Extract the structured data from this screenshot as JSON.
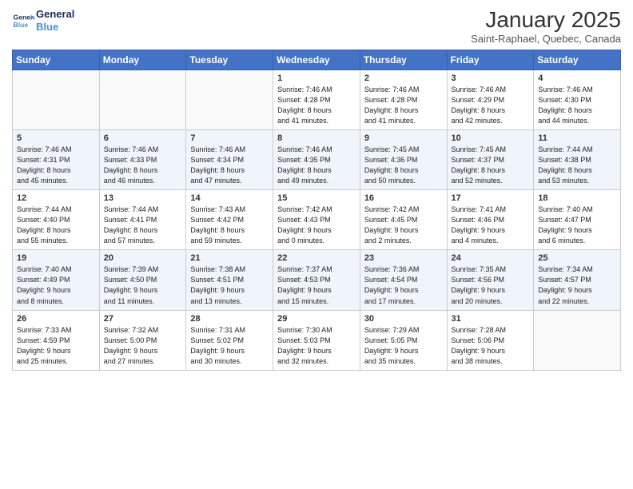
{
  "logo": {
    "line1": "General",
    "line2": "Blue"
  },
  "title": "January 2025",
  "subtitle": "Saint-Raphael, Quebec, Canada",
  "weekdays": [
    "Sunday",
    "Monday",
    "Tuesday",
    "Wednesday",
    "Thursday",
    "Friday",
    "Saturday"
  ],
  "weeks": [
    [
      {
        "day": "",
        "info": ""
      },
      {
        "day": "",
        "info": ""
      },
      {
        "day": "",
        "info": ""
      },
      {
        "day": "1",
        "info": "Sunrise: 7:46 AM\nSunset: 4:28 PM\nDaylight: 8 hours\nand 41 minutes."
      },
      {
        "day": "2",
        "info": "Sunrise: 7:46 AM\nSunset: 4:28 PM\nDaylight: 8 hours\nand 41 minutes."
      },
      {
        "day": "3",
        "info": "Sunrise: 7:46 AM\nSunset: 4:29 PM\nDaylight: 8 hours\nand 42 minutes."
      },
      {
        "day": "4",
        "info": "Sunrise: 7:46 AM\nSunset: 4:30 PM\nDaylight: 8 hours\nand 44 minutes."
      }
    ],
    [
      {
        "day": "5",
        "info": "Sunrise: 7:46 AM\nSunset: 4:31 PM\nDaylight: 8 hours\nand 45 minutes."
      },
      {
        "day": "6",
        "info": "Sunrise: 7:46 AM\nSunset: 4:33 PM\nDaylight: 8 hours\nand 46 minutes."
      },
      {
        "day": "7",
        "info": "Sunrise: 7:46 AM\nSunset: 4:34 PM\nDaylight: 8 hours\nand 47 minutes."
      },
      {
        "day": "8",
        "info": "Sunrise: 7:46 AM\nSunset: 4:35 PM\nDaylight: 8 hours\nand 49 minutes."
      },
      {
        "day": "9",
        "info": "Sunrise: 7:45 AM\nSunset: 4:36 PM\nDaylight: 8 hours\nand 50 minutes."
      },
      {
        "day": "10",
        "info": "Sunrise: 7:45 AM\nSunset: 4:37 PM\nDaylight: 8 hours\nand 52 minutes."
      },
      {
        "day": "11",
        "info": "Sunrise: 7:44 AM\nSunset: 4:38 PM\nDaylight: 8 hours\nand 53 minutes."
      }
    ],
    [
      {
        "day": "12",
        "info": "Sunrise: 7:44 AM\nSunset: 4:40 PM\nDaylight: 8 hours\nand 55 minutes."
      },
      {
        "day": "13",
        "info": "Sunrise: 7:44 AM\nSunset: 4:41 PM\nDaylight: 8 hours\nand 57 minutes."
      },
      {
        "day": "14",
        "info": "Sunrise: 7:43 AM\nSunset: 4:42 PM\nDaylight: 8 hours\nand 59 minutes."
      },
      {
        "day": "15",
        "info": "Sunrise: 7:42 AM\nSunset: 4:43 PM\nDaylight: 9 hours\nand 0 minutes."
      },
      {
        "day": "16",
        "info": "Sunrise: 7:42 AM\nSunset: 4:45 PM\nDaylight: 9 hours\nand 2 minutes."
      },
      {
        "day": "17",
        "info": "Sunrise: 7:41 AM\nSunset: 4:46 PM\nDaylight: 9 hours\nand 4 minutes."
      },
      {
        "day": "18",
        "info": "Sunrise: 7:40 AM\nSunset: 4:47 PM\nDaylight: 9 hours\nand 6 minutes."
      }
    ],
    [
      {
        "day": "19",
        "info": "Sunrise: 7:40 AM\nSunset: 4:49 PM\nDaylight: 9 hours\nand 8 minutes."
      },
      {
        "day": "20",
        "info": "Sunrise: 7:39 AM\nSunset: 4:50 PM\nDaylight: 9 hours\nand 11 minutes."
      },
      {
        "day": "21",
        "info": "Sunrise: 7:38 AM\nSunset: 4:51 PM\nDaylight: 9 hours\nand 13 minutes."
      },
      {
        "day": "22",
        "info": "Sunrise: 7:37 AM\nSunset: 4:53 PM\nDaylight: 9 hours\nand 15 minutes."
      },
      {
        "day": "23",
        "info": "Sunrise: 7:36 AM\nSunset: 4:54 PM\nDaylight: 9 hours\nand 17 minutes."
      },
      {
        "day": "24",
        "info": "Sunrise: 7:35 AM\nSunset: 4:56 PM\nDaylight: 9 hours\nand 20 minutes."
      },
      {
        "day": "25",
        "info": "Sunrise: 7:34 AM\nSunset: 4:57 PM\nDaylight: 9 hours\nand 22 minutes."
      }
    ],
    [
      {
        "day": "26",
        "info": "Sunrise: 7:33 AM\nSunset: 4:59 PM\nDaylight: 9 hours\nand 25 minutes."
      },
      {
        "day": "27",
        "info": "Sunrise: 7:32 AM\nSunset: 5:00 PM\nDaylight: 9 hours\nand 27 minutes."
      },
      {
        "day": "28",
        "info": "Sunrise: 7:31 AM\nSunset: 5:02 PM\nDaylight: 9 hours\nand 30 minutes."
      },
      {
        "day": "29",
        "info": "Sunrise: 7:30 AM\nSunset: 5:03 PM\nDaylight: 9 hours\nand 32 minutes."
      },
      {
        "day": "30",
        "info": "Sunrise: 7:29 AM\nSunset: 5:05 PM\nDaylight: 9 hours\nand 35 minutes."
      },
      {
        "day": "31",
        "info": "Sunrise: 7:28 AM\nSunset: 5:06 PM\nDaylight: 9 hours\nand 38 minutes."
      },
      {
        "day": "",
        "info": ""
      }
    ]
  ]
}
